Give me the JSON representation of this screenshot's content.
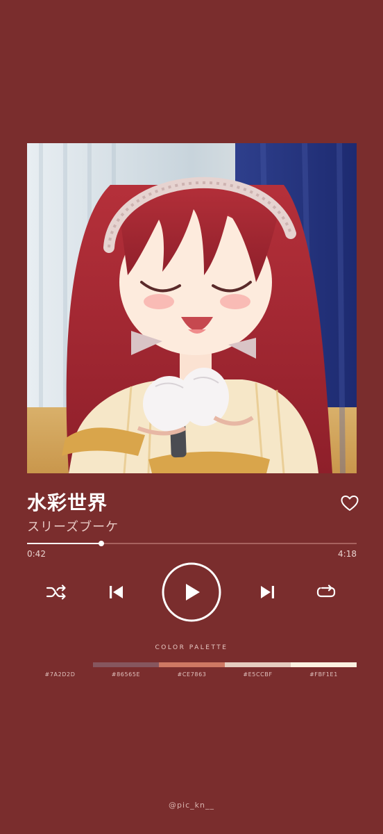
{
  "track": {
    "title": "水彩世界",
    "artist": "スリーズブーケ",
    "elapsed": "0:42",
    "duration": "4:18",
    "progress_fraction": 0.2262,
    "liked": false
  },
  "artwork": {
    "description_icon": "album-artwork"
  },
  "controls": {
    "shuffle": "shuffle-icon",
    "previous": "skip-previous-icon",
    "play": "play-icon",
    "next": "skip-next-icon",
    "repeat": "repeat-icon",
    "like": "heart-icon"
  },
  "palette": {
    "label": "COLOR PALETTE",
    "swatches": [
      {
        "hex": "#7A2D2D",
        "label": "#7A2D2D"
      },
      {
        "hex": "#86565E",
        "label": "#86565E"
      },
      {
        "hex": "#CE7863",
        "label": "#CE7863"
      },
      {
        "hex": "#E5CCBF",
        "label": "#E5CCBF"
      },
      {
        "hex": "#FBF1E1",
        "label": "#FBF1E1"
      }
    ]
  },
  "credit": "@pic_kn__",
  "colors": {
    "background": "#7A2D2D",
    "text": "#FFFFFF"
  }
}
